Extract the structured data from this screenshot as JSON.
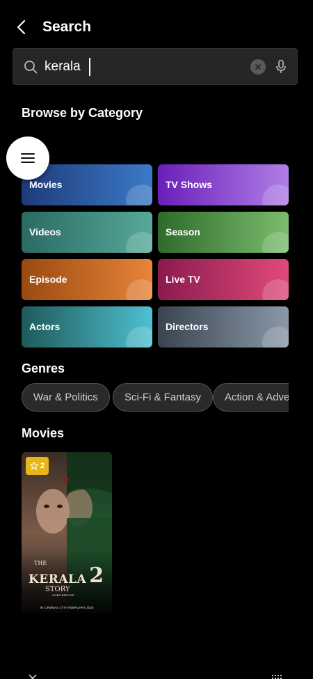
{
  "header": {
    "title": "Search"
  },
  "search": {
    "value": "kerala"
  },
  "browse": {
    "title": "Browse by Category",
    "categories": [
      {
        "label": "Movies",
        "color_start": "#1f3a7a",
        "color_end": "#3b7ac8"
      },
      {
        "label": "TV Shows",
        "color_start": "#6a1fb8",
        "color_end": "#b07ee6"
      },
      {
        "label": "Videos",
        "color_start": "#2a6a62",
        "color_end": "#57a99a"
      },
      {
        "label": "Season",
        "color_start": "#2f6a2a",
        "color_end": "#7bbd6e"
      },
      {
        "label": "Episode",
        "color_start": "#9a4a10",
        "color_end": "#e8843a"
      },
      {
        "label": "Live TV",
        "color_start": "#8a1a4e",
        "color_end": "#e04a7a"
      },
      {
        "label": "Actors",
        "color_start": "#1f5a5a",
        "color_end": "#4fc0d0"
      },
      {
        "label": "Directors",
        "color_start": "#3a4450",
        "color_end": "#8a98a8"
      }
    ]
  },
  "genres": {
    "title": "Genres",
    "items": [
      "War & Politics",
      "Sci-Fi & Fantasy",
      "Action & Adventure"
    ]
  },
  "movies": {
    "title": "Movies",
    "items": [
      {
        "rating": "2",
        "poster_title_line1": "THE",
        "poster_title_line2": "KERALA",
        "poster_title_line3": "STORY",
        "poster_number": "2",
        "poster_tagline": "GOES BEYOND",
        "poster_release": "IN CINEMAS 27TH FEBRUARY 2026"
      }
    ]
  },
  "icons": {
    "back": "chevron-left-icon",
    "search": "search-icon",
    "clear": "clear-icon",
    "mic": "microphone-icon",
    "menu": "menu-icon",
    "star": "star-icon"
  }
}
